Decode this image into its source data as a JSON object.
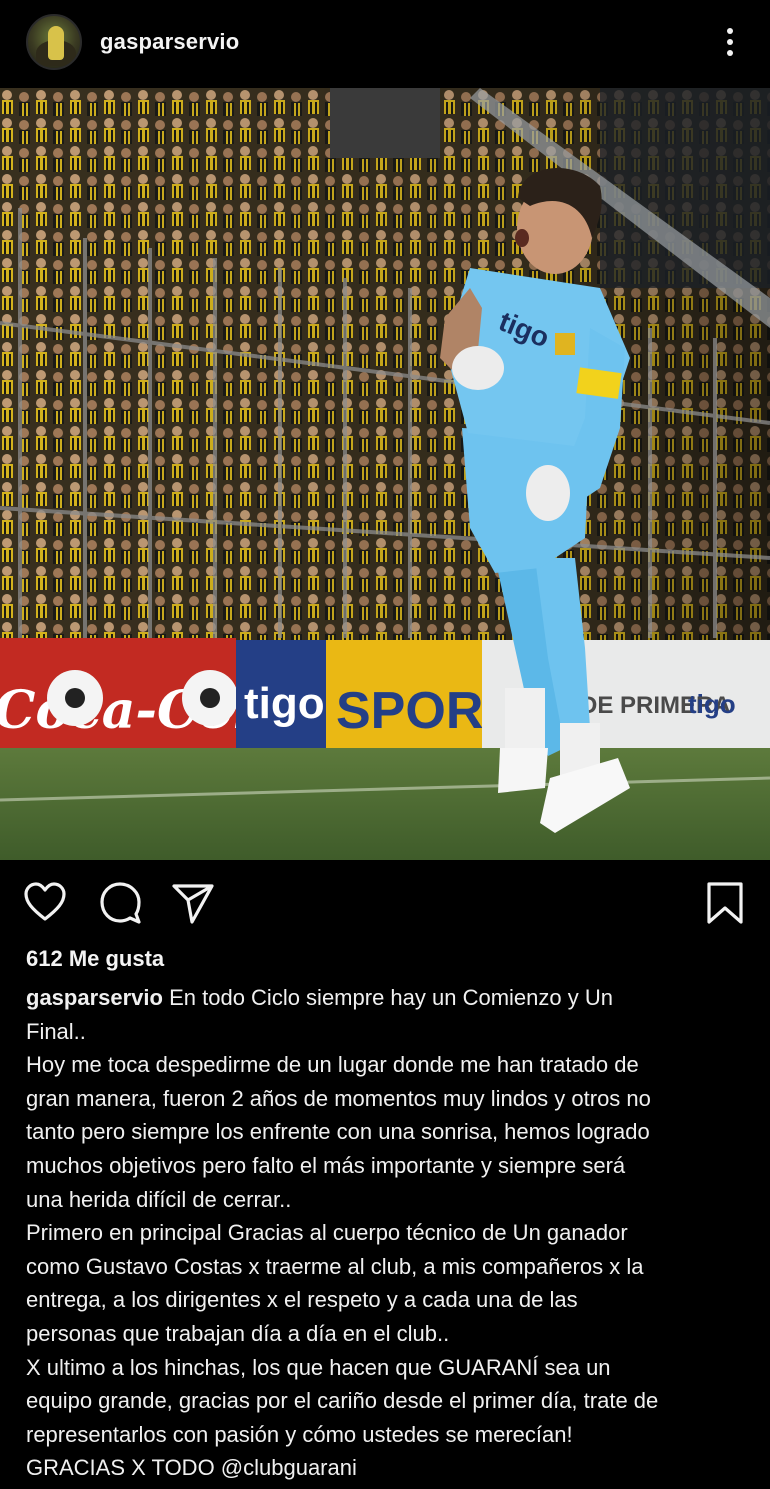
{
  "post": {
    "username": "gasparservio",
    "likes": "612 Me gusta"
  },
  "photo": {
    "ad_left": "Coca-Cola",
    "ad_tigo": "tigo",
    "ad_sports": "SPORTS",
    "banner_right": "DE PRIMERA",
    "banner_tigo": "tigo",
    "shirt_sponsor": "tigo"
  },
  "caption": {
    "username": "gasparservio",
    "lines": [
      "En todo Ciclo siempre hay un Comienzo y Un",
      "Final..",
      "Hoy me toca despedirme de un lugar donde me han tratado de",
      "gran manera, fueron 2 años de momentos muy lindos y otros no",
      "tanto pero siempre los enfrente con una sonrisa, hemos logrado",
      "muchos objetivos pero falto el más importante y siempre será",
      "una herida difícil de cerrar..",
      "Primero en principal Gracias al cuerpo técnico de Un ganador",
      "como Gustavo Costas x traerme al club, a mis compañeros x la",
      "entrega, a los dirigentes x el respeto y a cada una de las",
      "personas que trabajan día a día en el club..",
      "X ultimo a los hinchas, los que hacen que GUARANÍ sea un",
      "equipo grande, gracias por el cariño desde el primer día, trate de",
      "representarlos con pasión y cómo ustedes se merecían!",
      "GRACIAS X TODO @clubguarani"
    ]
  },
  "icons": [
    "heart-icon",
    "comment-icon",
    "share-icon",
    "bookmark-icon",
    "more-options-icon"
  ],
  "colors": {
    "background": "#000000",
    "text": "#f2f2f2",
    "kit_blue": "#6ec3ef",
    "club_yellow": "#e8c21a"
  }
}
